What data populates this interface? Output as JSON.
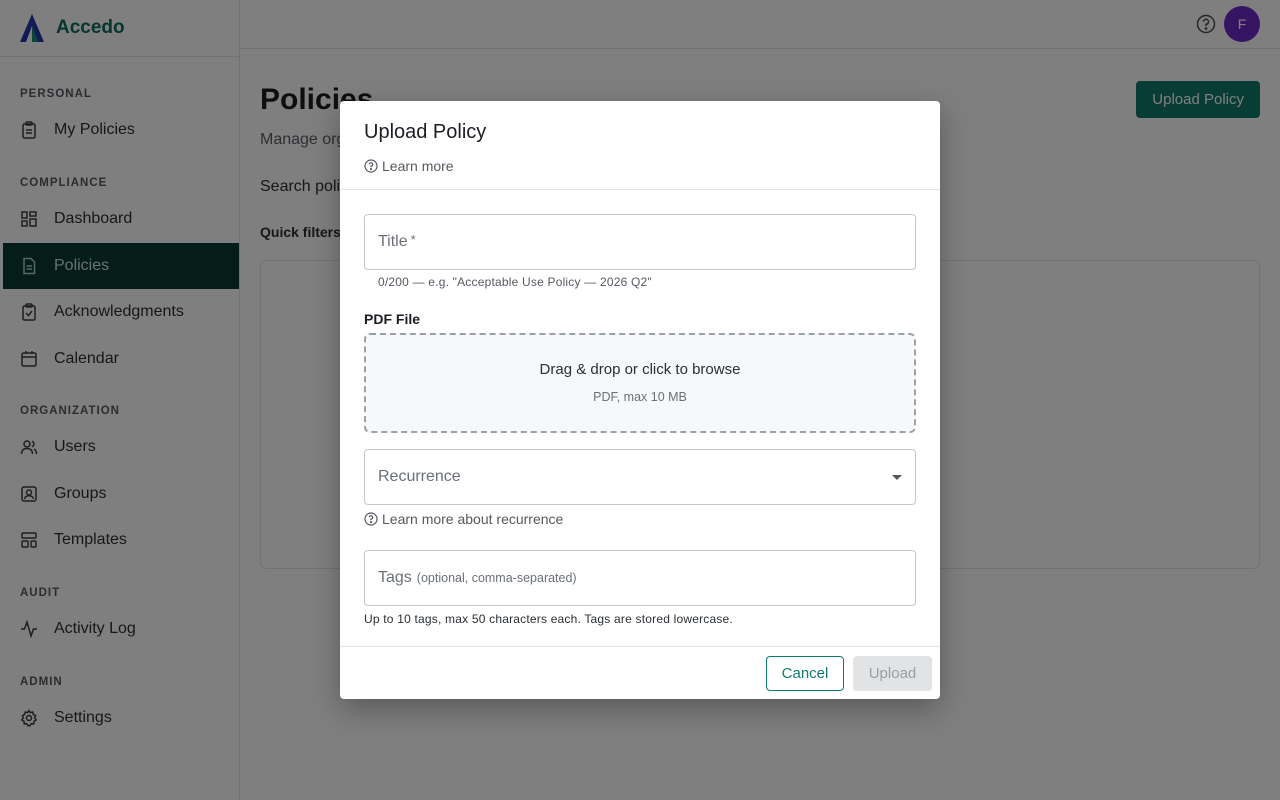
{
  "brand": {
    "name": "Accedo",
    "logo_icon": "accedo-logo-icon"
  },
  "sidebar": {
    "sections": [
      {
        "label": "PERSONAL"
      },
      {
        "label": "COMPLIANCE"
      },
      {
        "label": "ORGANIZATION"
      },
      {
        "label": "AUDIT"
      },
      {
        "label": "ADMIN"
      }
    ],
    "items": [
      {
        "label": "My Policies",
        "icon": "clipboard-icon"
      },
      {
        "label": "Dashboard",
        "icon": "dashboard-icon"
      },
      {
        "label": "Policies",
        "icon": "document-icon",
        "active": true
      },
      {
        "label": "Acknowledgments",
        "icon": "clipboard-check-icon"
      },
      {
        "label": "Calendar",
        "icon": "calendar-icon"
      },
      {
        "label": "Users",
        "icon": "users-icon"
      },
      {
        "label": "Groups",
        "icon": "group-icon"
      },
      {
        "label": "Templates",
        "icon": "templates-icon"
      },
      {
        "label": "Activity Log",
        "icon": "activity-icon"
      },
      {
        "label": "Settings",
        "icon": "gear-icon"
      }
    ]
  },
  "topbar": {
    "avatar_initial": "F",
    "help_icon": "help-circle-icon"
  },
  "main": {
    "title": "Policies",
    "subtitle": "Manage org",
    "search_label": "Search poli",
    "quick_filters": "Quick filters",
    "upload_button": "Upload Policy"
  },
  "modal": {
    "title": "Upload Policy",
    "learn_more": "Learn more",
    "title_field": {
      "label": "Title",
      "required_mark": "*",
      "helper": "0/200 — e.g. \"Acceptable Use Policy — 2026 Q2\""
    },
    "pdf": {
      "label": "PDF File",
      "drop_text": "Drag & drop or click to browse",
      "drop_hint": "PDF, max 10 MB"
    },
    "recurrence": {
      "label": "Recurrence",
      "learn_more": "Learn more about recurrence"
    },
    "tags": {
      "label": "Tags",
      "hint": "(optional, comma-separated)",
      "helper": "Up to 10 tags, max 50 characters each. Tags are stored lowercase."
    },
    "cancel": "Cancel",
    "upload": "Upload"
  },
  "colors": {
    "brand": "#0e6b5e",
    "active_nav": "#0b3a33",
    "primary_button": "#0f7a6b",
    "avatar": "#6d28c9"
  }
}
